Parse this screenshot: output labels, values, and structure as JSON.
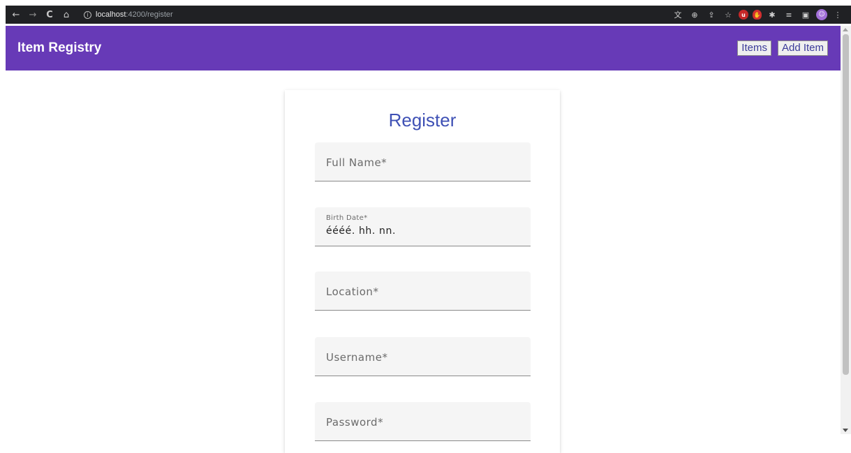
{
  "browser": {
    "url_host": "localhost",
    "url_path": ":4200/register",
    "nav": {
      "back": "←",
      "forward": "→",
      "reload": "C",
      "home": "⌂"
    }
  },
  "toolbar": {
    "title": "Item Registry",
    "items_label": "Items",
    "add_item_label": "Add Item"
  },
  "form": {
    "title": "Register",
    "fields": {
      "full_name": {
        "label": "Full Name*"
      },
      "birth_date": {
        "label": "Birth Date*",
        "value": "éééé. hh. nn."
      },
      "location": {
        "label": "Location*"
      },
      "username": {
        "label": "Username*"
      },
      "password": {
        "label": "Password*"
      }
    }
  },
  "colors": {
    "primary": "#673ab7",
    "title_accent": "#3f51b5"
  }
}
